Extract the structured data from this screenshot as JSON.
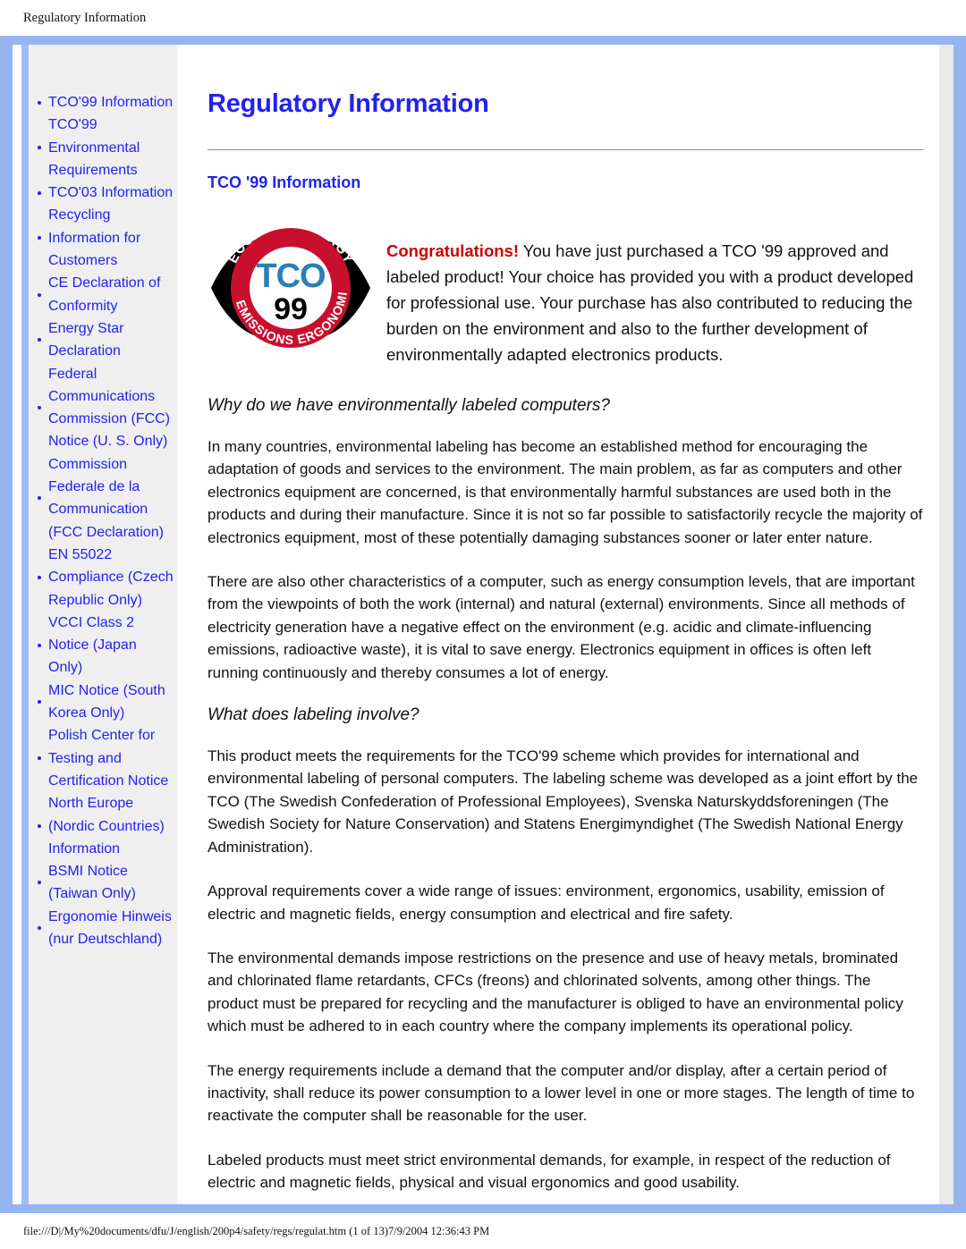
{
  "header": {
    "running_title": "Regulatory Information"
  },
  "sidebar": {
    "items": [
      {
        "label": "TCO'99 Information"
      },
      {
        "label": "TCO'99 Environmental Requirements"
      },
      {
        "label": "TCO'03 Information"
      },
      {
        "label": "Recycling Information for Customers"
      },
      {
        "label": "CE Declaration of Conformity"
      },
      {
        "label": "Energy Star Declaration"
      },
      {
        "label": "Federal Communications Commission (FCC) Notice (U. S. Only)"
      },
      {
        "label": "Commission Federale de la Communication (FCC Declaration)"
      },
      {
        "label": "EN 55022 Compliance (Czech Republic Only)"
      },
      {
        "label": "VCCI Class 2 Notice (Japan Only)"
      },
      {
        "label": "MIC Notice (South Korea Only)"
      },
      {
        "label": "Polish Center for Testing and Certification Notice"
      },
      {
        "label": "North Europe (Nordic Countries) Information"
      },
      {
        "label": "BSMI Notice (Taiwan Only)"
      },
      {
        "label": "Ergonomie Hinweis (nur Deutschland)"
      }
    ]
  },
  "main": {
    "title": "Regulatory Information",
    "section_title": "TCO '99 Information",
    "logo": {
      "name": "tco-99-seal",
      "top_text": "ECOLOGY ENERGY",
      "bottom_text": "EMISSIONS ERGONOMICS",
      "center_text": "TCO",
      "year_text": "99",
      "ring_color": "#c8102e",
      "letter_color": "#2a7fb8",
      "year_color": "#000000"
    },
    "congrats_lead": "Congratulations!",
    "congrats_body": " You have just purchased a TCO '99 approved and labeled product! Your choice has provided you with a product developed for professional use. Your purchase has also contributed to reducing the burden on the environment and also to the further development of environmentally adapted electronics products.",
    "subhead_1": "Why do we have environmentally labeled computers?",
    "para_1": "In many countries, environmental labeling has become an established method for encouraging the adaptation of goods and services to the environment. The main problem, as far as computers and other electronics equipment are concerned, is that environmentally harmful substances are used both in the products and during their manufacture. Since it is not so far possible to satisfactorily recycle the majority of electronics equipment, most of these potentially damaging substances sooner or later enter nature.",
    "para_2": "There are also other characteristics of a computer, such as energy consumption levels, that are important from the viewpoints of both the work (internal) and natural (external) environments. Since all methods of electricity generation have a negative effect on the environment (e.g. acidic and climate-influencing emissions, radioactive waste), it is vital to save energy. Electronics equipment in offices is often left running continuously and thereby consumes a lot of energy.",
    "subhead_2": "What does labeling involve?",
    "para_3": "This product meets the requirements for the TCO'99 scheme which provides for international and environmental labeling of personal computers. The labeling scheme was developed as a joint effort by the TCO (The Swedish Confederation of Professional Employees), Svenska Naturskyddsforeningen (The Swedish Society for Nature Conservation) and Statens Energimyndighet (The Swedish National Energy Administration).",
    "para_4": "Approval requirements cover a wide range of issues: environment, ergonomics, usability, emission of electric and magnetic fields, energy consumption and electrical and fire safety.",
    "para_5": "The environmental demands impose restrictions on the presence and use of heavy metals, brominated and chlorinated flame retardants, CFCs (freons) and chlorinated solvents, among other things. The product must be prepared for recycling and the manufacturer is obliged to have an environmental policy which must be adhered to in each country where the company implements its operational policy.",
    "para_6": "The energy requirements include a demand that the computer and/or display, after a certain period of inactivity, shall reduce its power consumption to a lower level in one or more stages. The length of time to reactivate the computer shall be reasonable for the user.",
    "para_7": "Labeled products must meet strict environmental demands, for example, in respect of the reduction of electric and magnetic fields, physical and visual ergonomics and good usability."
  },
  "footer": {
    "path_text": "file:///D|/My%20documents/dfu/J/english/200p4/safety/regs/regulat.htm (1 of 13)7/9/2004 12:36:43 PM"
  },
  "colors": {
    "link_blue": "#2222ee",
    "frame_blue": "#96b4f0",
    "sidebar_gray": "#efefef",
    "accent_red": "#cc0000",
    "rule_gray": "#8c8c8c"
  }
}
